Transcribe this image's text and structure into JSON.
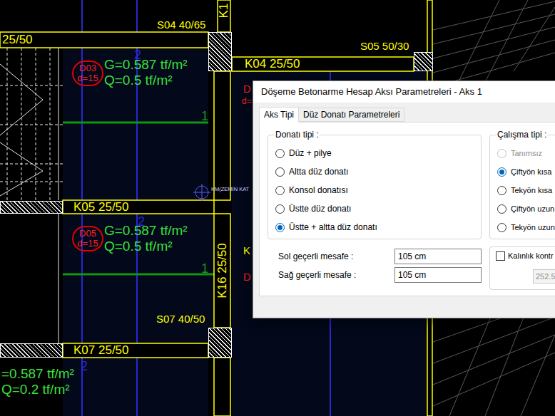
{
  "cad": {
    "beams": [
      {
        "label": "25/50"
      },
      {
        "label": "K04 25/50"
      },
      {
        "label": "K05 25/50"
      },
      {
        "label": "K07 25/50"
      },
      {
        "label": "K16 25/50"
      },
      {
        "label": "K1"
      }
    ],
    "columns": [
      {
        "label": "S04 40/65"
      },
      {
        "label": "S05 50/30"
      },
      {
        "label": "S07 40/50"
      }
    ],
    "slabs": [
      {
        "name": "D03",
        "thickness": "d=15",
        "dead_load": "G=0.587 tf/m²",
        "live_load": "Q=0.5 tf/m²"
      },
      {
        "name": "D05",
        "thickness": "d=15",
        "dead_load": "G=0.587 tf/m²",
        "live_load": "Q=0.5 tf/m²"
      }
    ],
    "partial_slab": {
      "dead_load": "=0.587 tf/m²",
      "live_load": "Q=0.2 tf/m²"
    },
    "axis_labels": [
      {
        "text": "2",
        "color": "#2828d0"
      },
      {
        "text": "2",
        "color": "#2828d0"
      },
      {
        "text": "2",
        "color": "#2828d0"
      },
      {
        "text": "1",
        "color": "#129612"
      },
      {
        "text": "1",
        "color": "#129612"
      }
    ],
    "hidden_labels": [
      {
        "text": "D",
        "color": "#ff2020"
      },
      {
        "text": "d=",
        "color": "#ff2020"
      },
      {
        "text": "K",
        "color": "#ffff00"
      },
      {
        "text": "D",
        "color": "#ff2020"
      }
    ],
    "reference_point": "KM(ZEMİN KAT"
  },
  "dialog": {
    "title": "Döşeme Betonarme Hesap Aksı Parametreleri - Aks 1",
    "tabs": [
      {
        "label": "Aks Tipi",
        "selected": true
      },
      {
        "label": "Düz Donatı Parametreleri",
        "selected": false
      }
    ],
    "reinforcement_group": {
      "label": "Donatı tipi :",
      "options": [
        {
          "label": "Düz + pilye",
          "selected": false
        },
        {
          "label": "Altta düz donatı",
          "selected": false
        },
        {
          "label": "Konsol donatısı",
          "selected": false
        },
        {
          "label": "Üstte düz donatı",
          "selected": false
        },
        {
          "label": "Üstte + altta düz donatı",
          "selected": true
        }
      ]
    },
    "working_group": {
      "label": "Çalışma tipi :",
      "options": [
        {
          "label": "Tanımsız",
          "selected": false,
          "disabled": true
        },
        {
          "label": "Çiftyön kısa",
          "selected": true,
          "disabled": false
        },
        {
          "label": "Tekyön kısa",
          "selected": false,
          "disabled": false
        },
        {
          "label": "Çiftyön uzun",
          "selected": false,
          "disabled": false
        },
        {
          "label": "Tekyön uzun",
          "selected": false,
          "disabled": false
        }
      ]
    },
    "distances": [
      {
        "label": "Sol geçerli mesafe :",
        "value": "105 cm"
      },
      {
        "label": "Sağ geçerli mesafe :",
        "value": "105 cm"
      }
    ],
    "thickness_check": {
      "label": "Kalınlık kontr",
      "checked": false,
      "value": "252.5",
      "disabled": true
    }
  }
}
